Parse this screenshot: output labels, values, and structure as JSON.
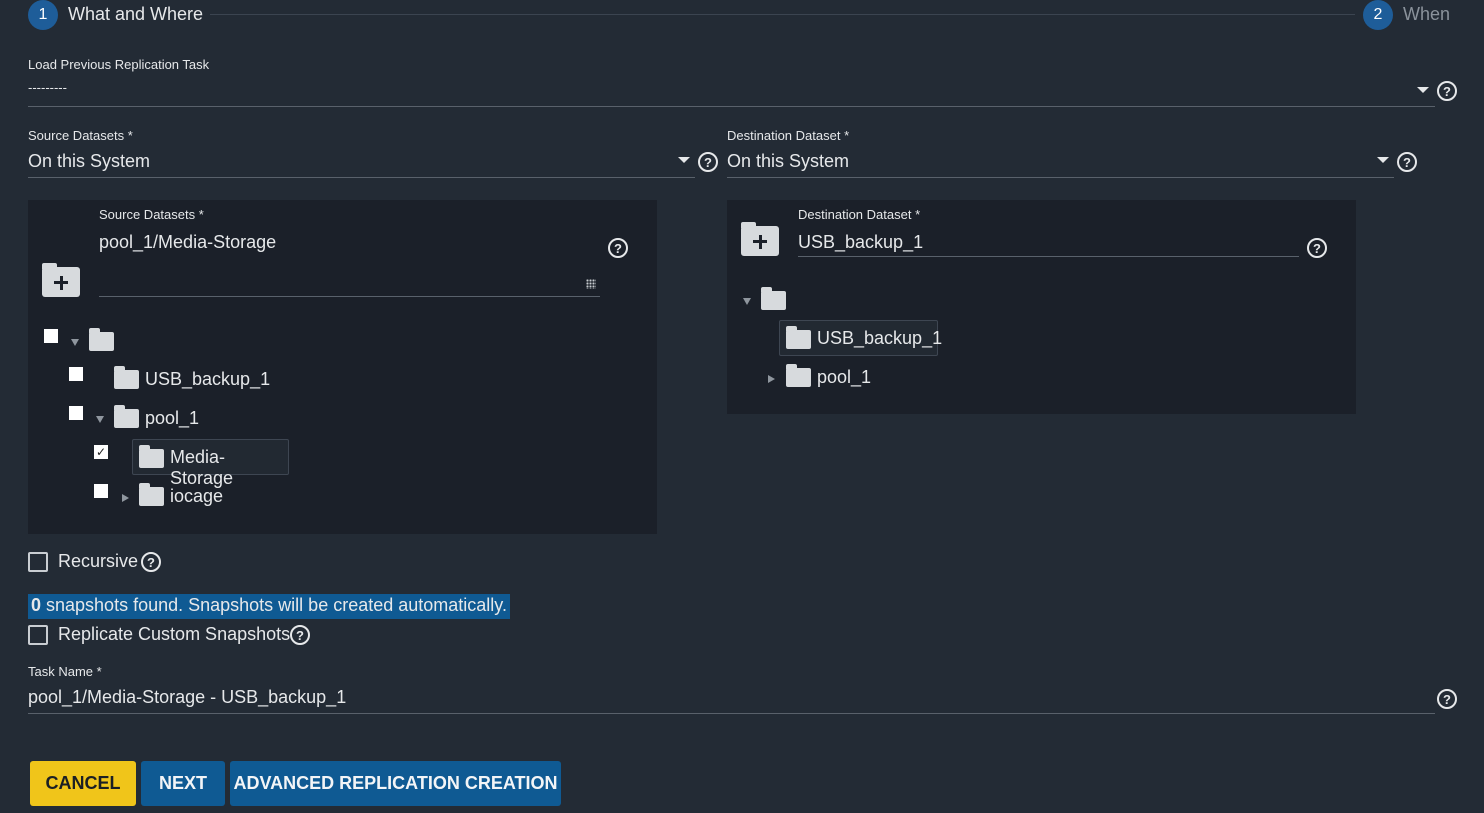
{
  "stepper": {
    "steps": [
      {
        "number": "1",
        "label": "What and Where",
        "active": true
      },
      {
        "number": "2",
        "label": "When",
        "active": false
      }
    ]
  },
  "load_previous": {
    "label": "Load Previous Replication Task",
    "value": "---------"
  },
  "source_select": {
    "label": "Source Datasets *",
    "value": "On this System"
  },
  "destination_select": {
    "label": "Destination Dataset *",
    "value": "On this System"
  },
  "source_panel": {
    "label": "Source Datasets *",
    "value": "pool_1/Media-Storage",
    "tree": {
      "root_label": "",
      "children": [
        {
          "label": "USB_backup_1",
          "checked": false
        },
        {
          "label": "pool_1",
          "checked": false,
          "expanded": true,
          "children": [
            {
              "label": "Media-Storage",
              "checked": true,
              "selected": true
            },
            {
              "label": "iocage",
              "checked": false,
              "expanded": false
            }
          ]
        }
      ]
    }
  },
  "destination_panel": {
    "label": "Destination Dataset *",
    "value": "USB_backup_1",
    "tree": {
      "root_label": "",
      "children": [
        {
          "label": "USB_backup_1",
          "selected": true
        },
        {
          "label": "pool_1",
          "expanded": false
        }
      ]
    }
  },
  "recursive": {
    "label": "Recursive",
    "checked": false
  },
  "snapshot_notice": {
    "count": "0",
    "text": " snapshots found. Snapshots will be created automatically."
  },
  "replicate_custom": {
    "label": "Replicate Custom Snapshots",
    "checked": false
  },
  "task_name": {
    "label": "Task Name *",
    "value": "pool_1/Media-Storage - USB_backup_1"
  },
  "buttons": {
    "cancel": "CANCEL",
    "next": "NEXT",
    "advanced": "ADVANCED REPLICATION CREATION"
  },
  "icons": {
    "help": "?",
    "checkmark": "✓"
  },
  "colors": {
    "background": "#232b35",
    "panel": "#1b2029",
    "accent_blue": "#0f5a93",
    "step_blue": "#1e5d99",
    "cancel_yellow": "#f0c51a"
  }
}
